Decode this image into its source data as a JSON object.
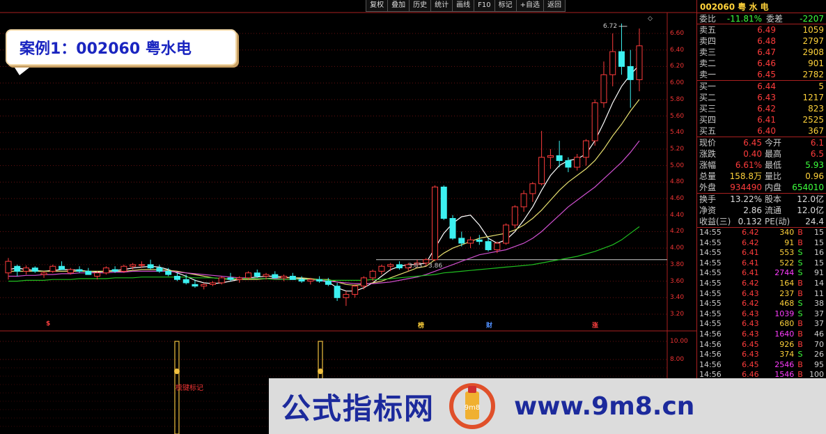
{
  "toolbar": {
    "items": [
      "复权",
      "叠加",
      "历史",
      "统计",
      "画线",
      "F10",
      "标记",
      "+自选",
      "返回"
    ]
  },
  "case_label": "案例1：002060 粤水电",
  "chart": {
    "price_axis": [
      "6.60",
      "6.40",
      "6.20",
      "6.00",
      "5.80",
      "5.60",
      "5.40",
      "5.20",
      "5.00",
      "4.80",
      "4.60",
      "4.40",
      "4.20",
      "4.00",
      "3.80",
      "3.60",
      "3.40",
      "3.20"
    ],
    "volume_axis": [
      "10.00",
      "8.00"
    ],
    "high_note": "6.72",
    "range_note": "3.85 - 3.86",
    "signal_label": "梳键标记",
    "markers": [
      {
        "text": "$",
        "color": "#ff4040"
      },
      {
        "text": "榜",
        "color": "#ffd23a"
      },
      {
        "text": "财",
        "color": "#5090ff"
      },
      {
        "text": "涨",
        "color": "#ff4040"
      }
    ],
    "diamond_icon": "◇"
  },
  "chart_data": {
    "type": "candlestick",
    "ylim": [
      3.2,
      6.72
    ],
    "candles": [
      [
        3.7,
        3.88,
        3.62,
        3.84
      ],
      [
        3.78,
        3.8,
        3.66,
        3.72
      ],
      [
        3.72,
        3.79,
        3.68,
        3.76
      ],
      [
        3.76,
        3.78,
        3.7,
        3.72
      ],
      [
        3.68,
        3.72,
        3.64,
        3.7
      ],
      [
        3.72,
        3.8,
        3.7,
        3.78
      ],
      [
        3.78,
        3.84,
        3.74,
        3.74
      ],
      [
        3.7,
        3.76,
        3.68,
        3.74
      ],
      [
        3.74,
        3.78,
        3.7,
        3.72
      ],
      [
        3.72,
        3.76,
        3.68,
        3.68
      ],
      [
        3.66,
        3.72,
        3.62,
        3.7
      ],
      [
        3.7,
        3.78,
        3.68,
        3.76
      ],
      [
        3.74,
        3.78,
        3.7,
        3.72
      ],
      [
        3.72,
        3.8,
        3.7,
        3.78
      ],
      [
        3.78,
        3.82,
        3.74,
        3.8
      ],
      [
        3.8,
        3.84,
        3.76,
        3.8
      ],
      [
        3.8,
        3.86,
        3.74,
        3.76
      ],
      [
        3.76,
        3.8,
        3.7,
        3.72
      ],
      [
        3.72,
        3.76,
        3.66,
        3.68
      ],
      [
        3.66,
        3.7,
        3.6,
        3.62
      ],
      [
        3.62,
        3.68,
        3.56,
        3.58
      ],
      [
        3.56,
        3.62,
        3.52,
        3.54
      ],
      [
        3.54,
        3.58,
        3.5,
        3.56
      ],
      [
        3.56,
        3.6,
        3.54,
        3.58
      ],
      [
        3.58,
        3.66,
        3.56,
        3.64
      ],
      [
        3.64,
        3.7,
        3.6,
        3.62
      ],
      [
        3.62,
        3.66,
        3.58,
        3.64
      ],
      [
        3.64,
        3.72,
        3.62,
        3.7
      ],
      [
        3.7,
        3.74,
        3.64,
        3.66
      ],
      [
        3.66,
        3.7,
        3.62,
        3.68
      ],
      [
        3.68,
        3.72,
        3.64,
        3.64
      ],
      [
        3.64,
        3.68,
        3.6,
        3.66
      ],
      [
        3.66,
        3.7,
        3.62,
        3.62
      ],
      [
        3.62,
        3.66,
        3.58,
        3.6
      ],
      [
        3.6,
        3.64,
        3.56,
        3.62
      ],
      [
        3.62,
        3.66,
        3.58,
        3.6
      ],
      [
        3.6,
        3.64,
        3.54,
        3.56
      ],
      [
        3.54,
        3.58,
        3.36,
        3.4
      ],
      [
        3.4,
        3.48,
        3.3,
        3.44
      ],
      [
        3.44,
        3.56,
        3.4,
        3.54
      ],
      [
        3.54,
        3.66,
        3.5,
        3.64
      ],
      [
        3.64,
        3.74,
        3.6,
        3.72
      ],
      [
        3.72,
        3.8,
        3.68,
        3.78
      ],
      [
        3.78,
        3.82,
        3.72,
        3.8
      ],
      [
        3.8,
        3.84,
        3.74,
        3.76
      ],
      [
        3.76,
        3.82,
        3.72,
        3.8
      ],
      [
        3.8,
        3.86,
        3.76,
        3.82
      ],
      [
        3.82,
        3.88,
        3.78,
        3.86
      ],
      [
        3.86,
        4.76,
        3.84,
        4.74
      ],
      [
        4.74,
        4.76,
        4.34,
        4.36
      ],
      [
        4.36,
        4.4,
        4.1,
        4.12
      ],
      [
        4.12,
        4.2,
        4.02,
        4.06
      ],
      [
        4.06,
        4.14,
        4.0,
        4.1
      ],
      [
        4.1,
        4.16,
        4.04,
        4.08
      ],
      [
        4.08,
        4.12,
        3.96,
        3.98
      ],
      [
        3.98,
        4.08,
        3.94,
        4.06
      ],
      [
        4.06,
        4.3,
        4.04,
        4.28
      ],
      [
        4.28,
        4.52,
        4.24,
        4.5
      ],
      [
        4.5,
        4.7,
        4.44,
        4.66
      ],
      [
        4.66,
        4.8,
        4.56,
        4.78
      ],
      [
        4.78,
        5.42,
        4.76,
        5.1
      ],
      [
        5.1,
        5.2,
        4.96,
        5.12
      ],
      [
        5.12,
        5.3,
        4.98,
        5.06
      ],
      [
        5.06,
        5.1,
        4.92,
        4.98
      ],
      [
        4.98,
        5.14,
        4.94,
        5.1
      ],
      [
        5.1,
        5.32,
        5.0,
        5.3
      ],
      [
        5.3,
        5.8,
        5.24,
        5.76
      ],
      [
        5.76,
        6.26,
        5.7,
        6.1
      ],
      [
        6.1,
        6.6,
        5.96,
        6.38
      ],
      [
        6.38,
        6.72,
        6.1,
        6.2
      ],
      [
        6.2,
        6.4,
        5.7,
        6.04
      ],
      [
        6.04,
        6.66,
        5.9,
        6.45
      ]
    ],
    "ma": [
      {
        "color": "#ffffff",
        "values": [
          3.74,
          3.76,
          3.74,
          3.73,
          3.72,
          3.73,
          3.74,
          3.74,
          3.73,
          3.72,
          3.71,
          3.72,
          3.73,
          3.74,
          3.76,
          3.77,
          3.78,
          3.77,
          3.74,
          3.7,
          3.66,
          3.61,
          3.58,
          3.57,
          3.58,
          3.6,
          3.62,
          3.64,
          3.65,
          3.66,
          3.66,
          3.65,
          3.64,
          3.63,
          3.62,
          3.61,
          3.59,
          3.52,
          3.48,
          3.48,
          3.52,
          3.58,
          3.66,
          3.74,
          3.78,
          3.8,
          3.8,
          3.82,
          4.0,
          4.18,
          4.3,
          4.38,
          4.4,
          4.28,
          4.12,
          4.06,
          4.1,
          4.2,
          4.34,
          4.5,
          4.7,
          4.88,
          5.0,
          5.06,
          5.08,
          5.14,
          5.3,
          5.52,
          5.76,
          5.96,
          6.1,
          6.22
        ]
      },
      {
        "color": "#e8e070",
        "values": [
          3.72,
          3.72,
          3.72,
          3.72,
          3.72,
          3.72,
          3.72,
          3.72,
          3.72,
          3.72,
          3.72,
          3.72,
          3.72,
          3.72,
          3.73,
          3.74,
          3.74,
          3.74,
          3.73,
          3.72,
          3.7,
          3.68,
          3.66,
          3.64,
          3.63,
          3.62,
          3.62,
          3.62,
          3.62,
          3.63,
          3.64,
          3.64,
          3.64,
          3.64,
          3.63,
          3.62,
          3.62,
          3.59,
          3.56,
          3.55,
          3.56,
          3.58,
          3.6,
          3.64,
          3.68,
          3.72,
          3.76,
          3.78,
          3.86,
          3.94,
          4.0,
          4.04,
          4.08,
          4.12,
          4.14,
          4.16,
          4.18,
          4.22,
          4.28,
          4.36,
          4.46,
          4.58,
          4.7,
          4.8,
          4.88,
          4.96,
          5.06,
          5.2,
          5.36,
          5.5,
          5.66,
          5.8
        ]
      },
      {
        "color": "#d050d0",
        "values": [
          3.66,
          3.66,
          3.67,
          3.67,
          3.68,
          3.68,
          3.69,
          3.69,
          3.7,
          3.7,
          3.7,
          3.7,
          3.71,
          3.71,
          3.72,
          3.72,
          3.72,
          3.72,
          3.72,
          3.71,
          3.7,
          3.69,
          3.68,
          3.67,
          3.66,
          3.65,
          3.64,
          3.64,
          3.63,
          3.63,
          3.63,
          3.62,
          3.62,
          3.62,
          3.62,
          3.61,
          3.6,
          3.59,
          3.58,
          3.57,
          3.57,
          3.57,
          3.58,
          3.59,
          3.61,
          3.63,
          3.65,
          3.68,
          3.72,
          3.76,
          3.8,
          3.84,
          3.88,
          3.92,
          3.94,
          3.96,
          3.98,
          4.02,
          4.06,
          4.12,
          4.2,
          4.3,
          4.4,
          4.5,
          4.58,
          4.66,
          4.74,
          4.84,
          4.94,
          5.04,
          5.16,
          5.3
        ]
      },
      {
        "color": "#20c020",
        "values": [
          3.6,
          3.6,
          3.61,
          3.61,
          3.61,
          3.62,
          3.62,
          3.62,
          3.63,
          3.63,
          3.63,
          3.63,
          3.64,
          3.64,
          3.64,
          3.65,
          3.65,
          3.65,
          3.65,
          3.65,
          3.65,
          3.64,
          3.64,
          3.64,
          3.63,
          3.63,
          3.63,
          3.63,
          3.63,
          3.63,
          3.62,
          3.62,
          3.62,
          3.62,
          3.62,
          3.62,
          3.61,
          3.61,
          3.61,
          3.61,
          3.61,
          3.62,
          3.62,
          3.63,
          3.64,
          3.65,
          3.66,
          3.67,
          3.68,
          3.7,
          3.71,
          3.72,
          3.73,
          3.74,
          3.75,
          3.76,
          3.77,
          3.78,
          3.79,
          3.8,
          3.82,
          3.84,
          3.86,
          3.88,
          3.9,
          3.93,
          3.96,
          4.0,
          4.04,
          4.1,
          4.18,
          4.26
        ]
      }
    ],
    "support_line": 3.86
  },
  "panel": {
    "code_name": "002060 粤 水 电",
    "webi": {
      "label": "委比",
      "value": "-11.81%",
      "label2": "委差",
      "value2": "-2207"
    },
    "asks": [
      {
        "label": "卖五",
        "price": "6.49",
        "vol": "1059"
      },
      {
        "label": "卖四",
        "price": "6.48",
        "vol": "2797"
      },
      {
        "label": "卖三",
        "price": "6.47",
        "vol": "2908"
      },
      {
        "label": "卖二",
        "price": "6.46",
        "vol": "901"
      },
      {
        "label": "卖一",
        "price": "6.45",
        "vol": "2782"
      }
    ],
    "bids": [
      {
        "label": "买一",
        "price": "6.44",
        "vol": "5"
      },
      {
        "label": "买二",
        "price": "6.43",
        "vol": "1217"
      },
      {
        "label": "买三",
        "price": "6.42",
        "vol": "823"
      },
      {
        "label": "买四",
        "price": "6.41",
        "vol": "2525"
      },
      {
        "label": "买五",
        "price": "6.40",
        "vol": "367"
      }
    ],
    "quote": [
      {
        "l1": "现价",
        "v1": "6.45",
        "c1": "red",
        "l2": "今开",
        "v2": "6.1",
        "c2": "red"
      },
      {
        "l1": "涨跌",
        "v1": "0.40",
        "c1": "red",
        "l2": "最高",
        "v2": "6.5",
        "c2": "red"
      },
      {
        "l1": "涨幅",
        "v1": "6.61%",
        "c1": "red",
        "l2": "最低",
        "v2": "5.93",
        "c2": "grn"
      },
      {
        "l1": "总量",
        "v1": "158.8万",
        "c1": "yel",
        "l2": "量比",
        "v2": "0.96",
        "c2": "yel"
      },
      {
        "l1": "外盘",
        "v1": "934490",
        "c1": "red",
        "l2": "内盘",
        "v2": "654010",
        "c2": "grn"
      }
    ],
    "info": [
      {
        "l1": "换手",
        "v1": "13.22%",
        "l2": "股本",
        "v2": "12.0亿"
      },
      {
        "l1": "净资",
        "v1": "2.86",
        "l2": "流通",
        "v2": "12.0亿"
      },
      {
        "l1": "收益(三)",
        "v1": "0.132",
        "l2": "PE(动)",
        "v2": "24.4"
      }
    ],
    "ticks": [
      {
        "t": "14:55",
        "p": "6.42",
        "v": "340",
        "d": "B",
        "n": "15"
      },
      {
        "t": "14:55",
        "p": "6.42",
        "v": "91",
        "d": "B",
        "n": "15"
      },
      {
        "t": "14:55",
        "p": "6.41",
        "v": "553",
        "d": "S",
        "n": "16"
      },
      {
        "t": "14:55",
        "p": "6.41",
        "v": "522",
        "d": "S",
        "n": "15"
      },
      {
        "t": "14:55",
        "p": "6.41",
        "v": "2744",
        "d": "S",
        "n": "91"
      },
      {
        "t": "14:55",
        "p": "6.42",
        "v": "164",
        "d": "B",
        "n": "14"
      },
      {
        "t": "14:55",
        "p": "6.43",
        "v": "237",
        "d": "B",
        "n": "11"
      },
      {
        "t": "14:55",
        "p": "6.42",
        "v": "468",
        "d": "S",
        "n": "38"
      },
      {
        "t": "14:55",
        "p": "6.43",
        "v": "1039",
        "d": "S",
        "n": "37"
      },
      {
        "t": "14:55",
        "p": "6.43",
        "v": "680",
        "d": "B",
        "n": "37"
      },
      {
        "t": "14:56",
        "p": "6.43",
        "v": "1640",
        "d": "B",
        "n": "46"
      },
      {
        "t": "14:56",
        "p": "6.45",
        "v": "926",
        "d": "B",
        "n": "70"
      },
      {
        "t": "14:56",
        "p": "6.43",
        "v": "374",
        "d": "S",
        "n": "26"
      },
      {
        "t": "14:56",
        "p": "6.45",
        "v": "2546",
        "d": "B",
        "n": "95"
      },
      {
        "t": "14:56",
        "p": "6.46",
        "v": "1546",
        "d": "B",
        "n": "100"
      }
    ]
  },
  "banner": {
    "cn": "公式指标网",
    "url": "www.9m8.cn",
    "logo_text": "www.9m8.cn"
  }
}
